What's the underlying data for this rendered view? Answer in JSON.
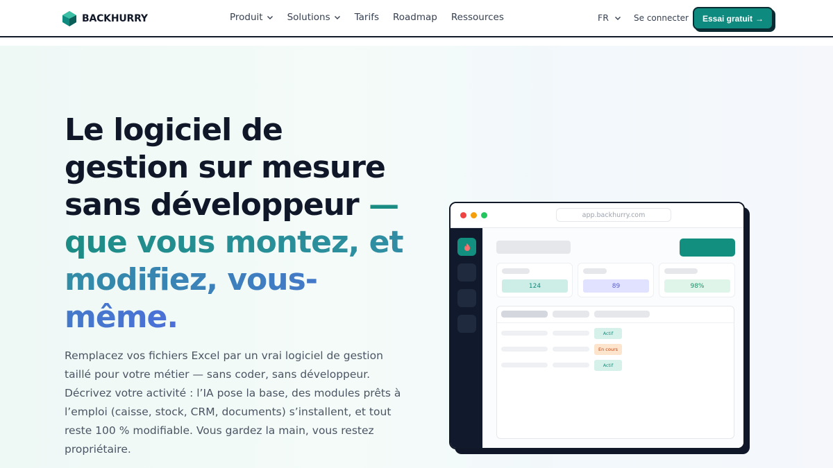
{
  "brand": {
    "name": "BACKHURRY"
  },
  "nav": {
    "items": [
      {
        "label": "Produit",
        "dropdown": true
      },
      {
        "label": "Solutions",
        "dropdown": true
      },
      {
        "label": "Tarifs",
        "dropdown": false
      },
      {
        "label": "Roadmap",
        "dropdown": false
      },
      {
        "label": "Ressources",
        "dropdown": false
      }
    ],
    "lang": "FR",
    "login": "Se connecter",
    "cta": "Essai gratuit",
    "cta_icon": "arrow-right-icon"
  },
  "hero": {
    "headline_plain": "Le logiciel de gestion sur mesure sans développeur",
    "headline_accent": "— que vous montez, et modifiez, vous-même.",
    "paragraph": "Remplacez vos fichiers Excel par un vrai logiciel de gestion taillé pour votre métier — sans coder, sans développeur. Décrivez votre activité : l’IA pose la base, des modules prêts à l’emploi (caisse, stock, CRM, documents) s’installent, et tout reste 100 % modifiable. Vous gardez la main, vous restez propriétaire."
  },
  "mockup": {
    "url": "app.backhurry.com",
    "stats": [
      "124",
      "89",
      "98%"
    ],
    "badges": [
      "Actif",
      "En cours",
      "Actif"
    ]
  },
  "colors": {
    "brand": "#0f8a7e",
    "dark": "#0f1729",
    "accent_blue": "#4c70d9"
  }
}
